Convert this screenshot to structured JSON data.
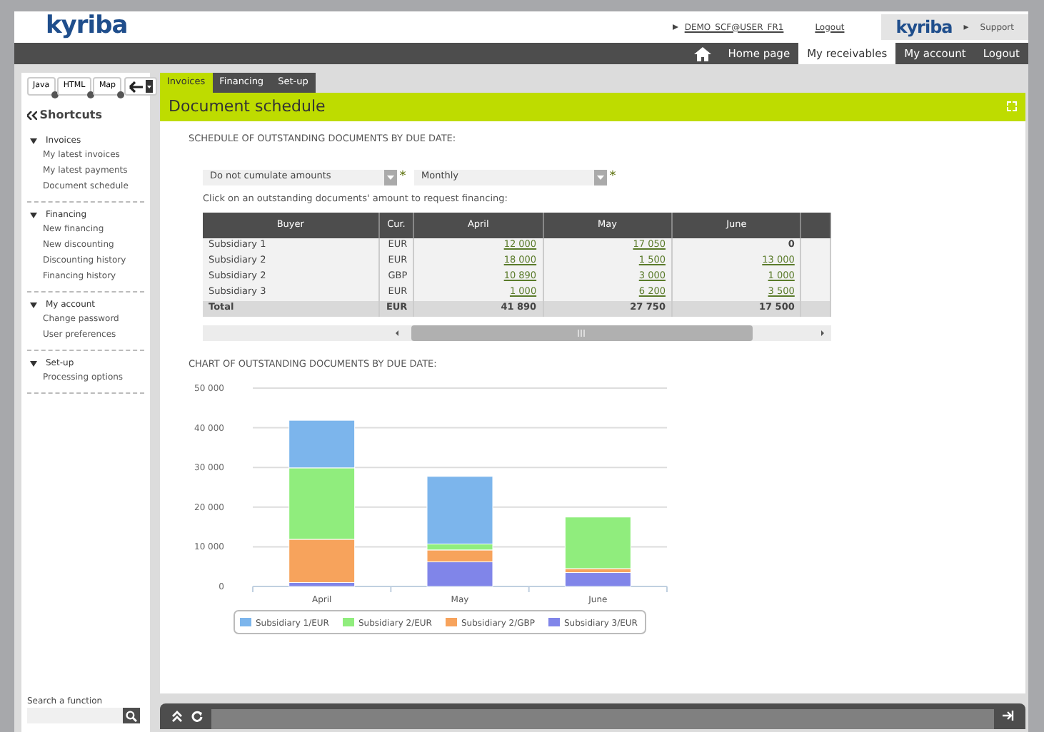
{
  "header": {
    "logo": "kyriba",
    "user_link": "DEMO_SCF@USER_FR1",
    "logout": "Logout",
    "support_box": {
      "logo": "kyriba",
      "arrow": "▸",
      "label": "Support"
    }
  },
  "nav": [
    {
      "label": "Home page",
      "selected": false
    },
    {
      "label": "My receivables",
      "selected": true
    },
    {
      "label": "My account",
      "selected": false
    },
    {
      "label": "Logout",
      "selected": false
    }
  ],
  "sidebar": {
    "tool_buttons": [
      "Java",
      "HTML",
      "Map"
    ],
    "title": "Shortcuts",
    "sections": [
      {
        "label": "Invoices",
        "expanded": true,
        "children": [
          {
            "label": "My latest invoices"
          },
          {
            "label": "My latest payments"
          },
          {
            "label": "Document schedule"
          }
        ]
      },
      {
        "label": "Financing",
        "expanded": true,
        "children": [
          {
            "label": "New financing"
          },
          {
            "label": "New discounting"
          },
          {
            "label": "Discounting history"
          },
          {
            "label": "Financing history"
          }
        ]
      },
      {
        "label": "My account",
        "expanded": true,
        "children": [
          {
            "label": "Change password"
          },
          {
            "label": "User preferences"
          }
        ]
      },
      {
        "label": "Set-up",
        "expanded": true,
        "children": [
          {
            "label": "Processing options"
          }
        ]
      }
    ],
    "search_label": "Search a function"
  },
  "tabs": [
    {
      "label": "Invoices",
      "selected": true
    },
    {
      "label": "Financing",
      "selected": false
    },
    {
      "label": "Set-up",
      "selected": false
    }
  ],
  "page_title": "Document schedule",
  "schedule": {
    "heading": "SCHEDULE OF OUTSTANDING DOCUMENTS BY DUE DATE:",
    "selects": [
      {
        "value": "Do not cumulate amounts",
        "required_mark": "*"
      },
      {
        "value": "Monthly",
        "required_mark": "*"
      }
    ],
    "hint": "Click on an outstanding documents' amount to request financing:",
    "columns": [
      "Buyer",
      "Cur.",
      "April",
      "May",
      "June"
    ],
    "rows": [
      {
        "buyer": "Subsidiary 1",
        "currency": "EUR",
        "amounts": [
          {
            "text": "12 000",
            "link": true
          },
          {
            "text": "17 050",
            "link": true
          },
          {
            "text": "0",
            "link": false
          }
        ]
      },
      {
        "buyer": "Subsidiary 2",
        "currency": "EUR",
        "amounts": [
          {
            "text": "18 000",
            "link": true
          },
          {
            "text": "1 500",
            "link": true
          },
          {
            "text": "13 000",
            "link": true
          }
        ]
      },
      {
        "buyer": "Subsidiary 2",
        "currency": "GBP",
        "amounts": [
          {
            "text": "10 890",
            "link": true
          },
          {
            "text": "3 000",
            "link": true
          },
          {
            "text": "1 000",
            "link": true
          }
        ]
      },
      {
        "buyer": "Subsidiary 3",
        "currency": "EUR",
        "amounts": [
          {
            "text": "1 000",
            "link": true
          },
          {
            "text": "6 200",
            "link": true
          },
          {
            "text": "3 500",
            "link": true
          }
        ]
      }
    ],
    "total": {
      "buyer": "Total",
      "currency": "EUR",
      "amounts": [
        "41 890",
        "27 750",
        "17 500"
      ]
    }
  },
  "chart": {
    "heading": "CHART OF OUTSTANDING DOCUMENTS BY DUE DATE:",
    "chart_data": {
      "type": "bar",
      "stacked": true,
      "categories": [
        "April",
        "May",
        "June"
      ],
      "series": [
        {
          "name": "Subsidiary 1/EUR",
          "color": "#7cb5ec",
          "values": [
            12000,
            17050,
            0
          ]
        },
        {
          "name": "Subsidiary 2/EUR",
          "color": "#90ed7d",
          "values": [
            18000,
            1500,
            13000
          ]
        },
        {
          "name": "Subsidiary 2/GBP",
          "color": "#f7a35c",
          "values": [
            10890,
            3000,
            1000
          ]
        },
        {
          "name": "Subsidiary 3/EUR",
          "color": "#8085e9",
          "values": [
            1000,
            6200,
            3500
          ]
        }
      ],
      "ylim": [
        0,
        50000
      ],
      "grid": true,
      "legend": true,
      "yticks": [
        {
          "value": 0,
          "label": "0"
        },
        {
          "value": 10000,
          "label": "10 000"
        },
        {
          "value": 20000,
          "label": "20 000"
        },
        {
          "value": 30000,
          "label": "30 000"
        },
        {
          "value": 40000,
          "label": "40 000"
        },
        {
          "value": 50000,
          "label": "50 000"
        }
      ]
    }
  }
}
